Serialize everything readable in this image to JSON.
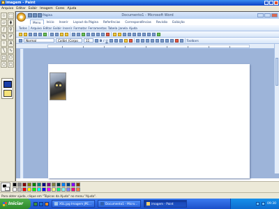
{
  "paint": {
    "title": "imagem - Paint",
    "menu": [
      "Arquivo",
      "Editar",
      "Exibir",
      "Imagem",
      "Cores",
      "Ajuda"
    ],
    "status": "Para obter ajuda, clique em \"Tópicos da Ajuda\" no menu \"Ajuda\"."
  },
  "word": {
    "title": "Documento1 - Microsoft Word",
    "qat_label": "Página",
    "tabs": [
      "Menu",
      "Início",
      "Inserir",
      "Layout da Página",
      "Referências",
      "Correspondências",
      "Revisão",
      "Exibição"
    ],
    "menu_row": [
      "Todos",
      "Arquivo",
      "Editar",
      "Exibir",
      "Inserir",
      "Formatar",
      "Ferramentas",
      "Tabela",
      "Janela",
      "Ajuda"
    ],
    "style_value": "Normal",
    "font_value": "Calibri (Corpo",
    "size_value": "11",
    "toolbars_label": "Toolbars"
  },
  "palette_colors": [
    "#000000",
    "#808080",
    "#800000",
    "#808000",
    "#008000",
    "#008080",
    "#000080",
    "#800080",
    "#808040",
    "#004040",
    "#0080ff",
    "#004080",
    "#8000ff",
    "#804000",
    "#ffffff",
    "#c0c0c0",
    "#ff0000",
    "#ffff00",
    "#00ff00",
    "#00ffff",
    "#0000ff",
    "#ff00ff",
    "#ffff80",
    "#00ff80",
    "#80ffff",
    "#8080ff",
    "#ff0080",
    "#ff8040"
  ],
  "taskbar": {
    "start_label": "Iniciar",
    "buttons": [
      {
        "label": "XSL.jpg Imagem JPE...",
        "active": false
      },
      {
        "label": "Documento1 - Micro...",
        "active": false
      },
      {
        "label": "imagem - Paint",
        "active": true
      }
    ],
    "clock": "09:30"
  }
}
